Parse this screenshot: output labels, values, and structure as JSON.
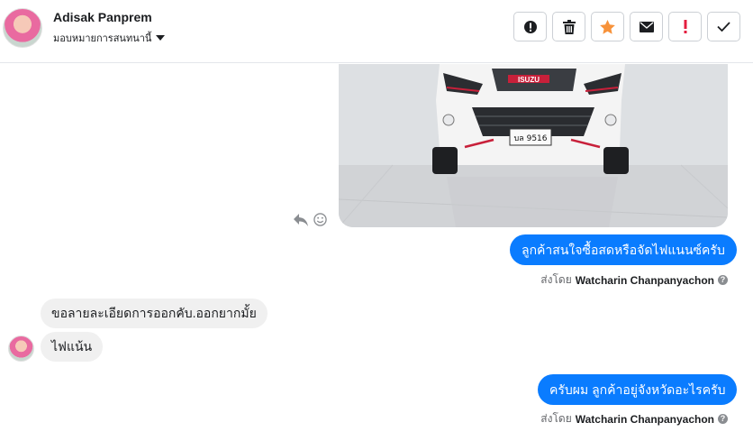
{
  "header": {
    "contact_name": "Adisak Panprem",
    "assign_label": "มอบหมายการสนทนานี้"
  },
  "toolbar": {
    "icons": [
      "alert-circle-icon",
      "trash-icon",
      "star-icon",
      "envelope-icon",
      "exclamation-icon",
      "check-icon"
    ],
    "star_color": "#f7923a",
    "exclamation_color": "#e41e3f"
  },
  "messages": {
    "out_1": "ลูกค้าสนใจซื้อสดหรือจัดไฟแนนซ์ครับ",
    "in_1": "ขอลายละเอียดการออกคับ.ออกยากมั้ย",
    "in_2": "ไฟแน้น",
    "out_2": "ครับผม ลูกค้าอยู่จังหวัดอะไรครับ",
    "sent_by_prefix": "ส่งโดย",
    "sender": "Watcharin Chanpanyachon"
  },
  "photo": {
    "brand_badge": "ISUZU",
    "plate": "บล 9516"
  },
  "colors": {
    "outgoing_bubble": "#0a7cff",
    "incoming_bubble": "#f0f0f0"
  }
}
